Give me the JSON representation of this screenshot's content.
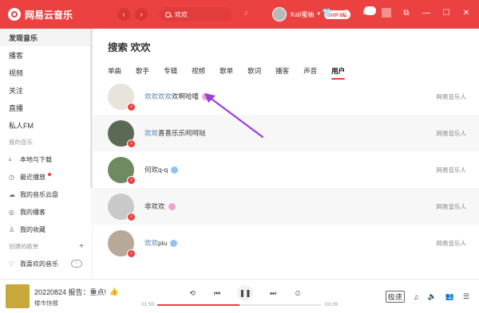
{
  "app": {
    "name": "网易云音乐"
  },
  "topbar": {
    "back": "‹",
    "forward": "›",
    "search_value": "欢欢",
    "user_name": "Kali蜜柚",
    "vip_label": "SVIP 8级",
    "mail_count": "33"
  },
  "sidebar": {
    "top_items": [
      "发现音乐",
      "播客",
      "视频",
      "关注",
      "直播",
      "私人FM"
    ],
    "my_music_header": "我的音乐",
    "my_items": [
      "本地与下载",
      "最近播放",
      "我的音乐云盘",
      "我的播客",
      "我的收藏"
    ],
    "created_header": "创建的歌单",
    "created_items": [
      "我喜欢的音乐"
    ]
  },
  "main": {
    "title": "搜索 欢欢",
    "tabs": [
      "单曲",
      "歌手",
      "专辑",
      "视频",
      "歌单",
      "歌词",
      "播客",
      "声音",
      "用户"
    ],
    "active_tab": "用户",
    "users": [
      {
        "hl": "欢欢欢欢",
        "rest": "欢啊哈嘻",
        "badge": "pink",
        "source": "网易音乐人",
        "color": "#e8e4dc"
      },
      {
        "hl": "欢欢",
        "rest": "喜喜乐乐呵呵哒",
        "badge": "",
        "source": "网易音乐人",
        "color": "#5a6a55"
      },
      {
        "hl": "",
        "rest": "何欢q-q",
        "badge": "blue",
        "source": "网易音乐人",
        "color": "#6f8a60"
      },
      {
        "hl": "",
        "rest": "非欢欢",
        "badge": "pink",
        "source": "网易音乐人",
        "color": "#c9c9c9"
      },
      {
        "hl": "欢欢",
        "rest": "piu",
        "badge": "blue",
        "source": "网易音乐人",
        "color": "#b8a898"
      }
    ]
  },
  "player": {
    "song": "20220824 报告：重点!",
    "artist": "楼市快报",
    "current_time": "01:50",
    "total_time": "03:39",
    "progress": 0.5,
    "quality": "极速"
  },
  "colors": {
    "accent": "#ec4141",
    "highlight": "#507daf"
  }
}
